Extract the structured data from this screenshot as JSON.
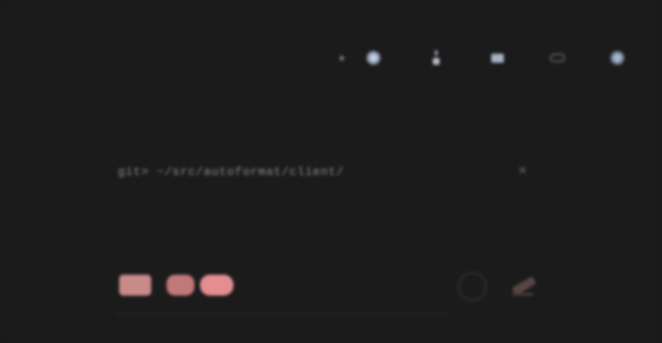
{
  "toolbar": {
    "icons": [
      "small-dot-icon",
      "ring-icon",
      "pin-icon",
      "mail-icon",
      "chat-icon",
      "gear-icon"
    ]
  },
  "command": {
    "text": "git> ~/src/autoformat/client/",
    "clear_symbol": "✕"
  },
  "actions": {
    "buttons": [
      "tag-button",
      "draft-button",
      "primary-button",
      "record-button",
      "edit-button"
    ]
  },
  "colors": {
    "background": "#1b1b1b",
    "accent_pink": "#e48e92",
    "icon_blue": "#aab6cc"
  }
}
